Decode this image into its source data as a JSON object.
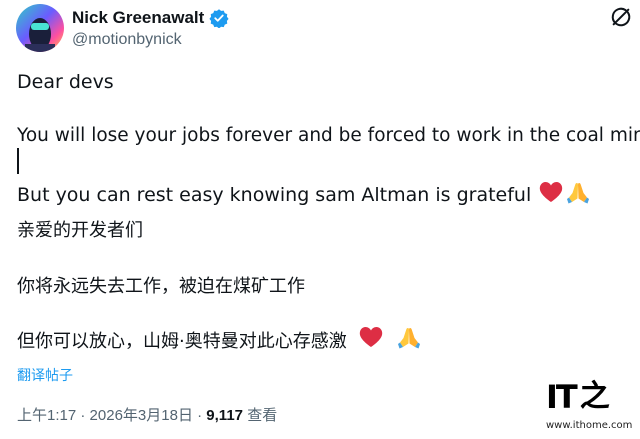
{
  "author": {
    "display_name": "Nick Greenawalt",
    "handle": "@motionbynick",
    "verified": true
  },
  "tweet": {
    "line1": "Dear devs",
    "line2": "You will lose your jobs forever and be forced to work in the coal mines",
    "line3": "But you can rest easy knowing sam Altman is grateful",
    "line3_emojis": [
      "red-heart-icon",
      "folded-hands-icon"
    ],
    "line4": "亲爱的开发者们",
    "line5": "你将永远失去工作，被迫在煤矿工作",
    "line6": "但你可以放心，山姆·奥特曼对此心存感激",
    "line6_emojis": [
      "red-heart-icon",
      "folded-hands-icon"
    ]
  },
  "translate_label": "翻译帖子",
  "meta": {
    "time": "上午1:17",
    "date": "2026年3月18日",
    "views_count": "9,117",
    "views_label": "查看",
    "separator": "·"
  },
  "watermark": {
    "logo_text": "IT",
    "logo_char": "之",
    "url": "www.ithome.com"
  },
  "colors": {
    "verified_blue": "#1d9bf0",
    "link_blue": "#1d9bf0",
    "secondary_text": "#536471",
    "primary_text": "#0f1419",
    "heart_red": "#dd2e44",
    "hands_yellow": "#ffc83d"
  }
}
